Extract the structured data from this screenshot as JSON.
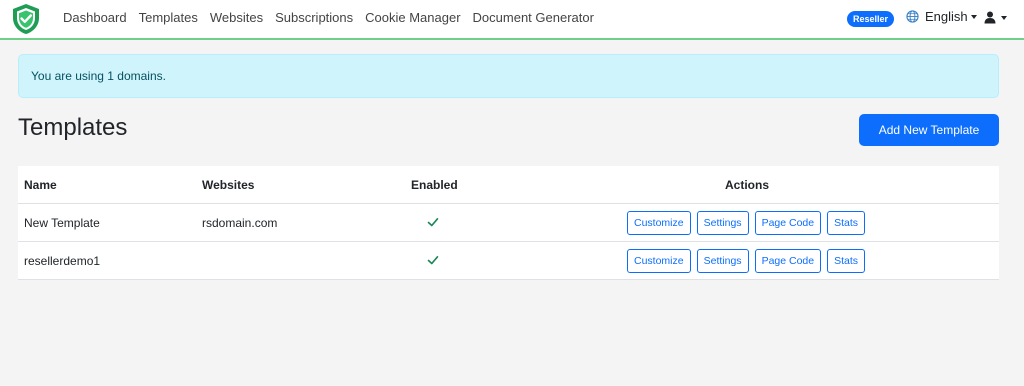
{
  "nav": {
    "links": [
      "Dashboard",
      "Templates",
      "Websites",
      "Subscriptions",
      "Cookie Manager",
      "Document Generator"
    ],
    "badge": "Reseller",
    "language": "English",
    "logo_icon": "shield-check-icon",
    "globe_icon": "globe-icon",
    "user_icon": "user-icon"
  },
  "alert": {
    "text": "You are using 1 domains."
  },
  "page": {
    "title": "Templates",
    "add_button": "Add New Template"
  },
  "table": {
    "headers": {
      "name": "Name",
      "websites": "Websites",
      "enabled": "Enabled",
      "actions": "Actions"
    },
    "rows": [
      {
        "name": "New Template",
        "websites": "rsdomain.com",
        "enabled": true
      },
      {
        "name": "resellerdemo1",
        "websites": "",
        "enabled": true
      }
    ],
    "action_labels": [
      "Customize",
      "Settings",
      "Page Code",
      "Stats"
    ]
  },
  "colors": {
    "accent": "#0d6efd",
    "nav_border": "#6fcf8a",
    "check": "#198754",
    "alert_bg": "#cff4fc"
  }
}
